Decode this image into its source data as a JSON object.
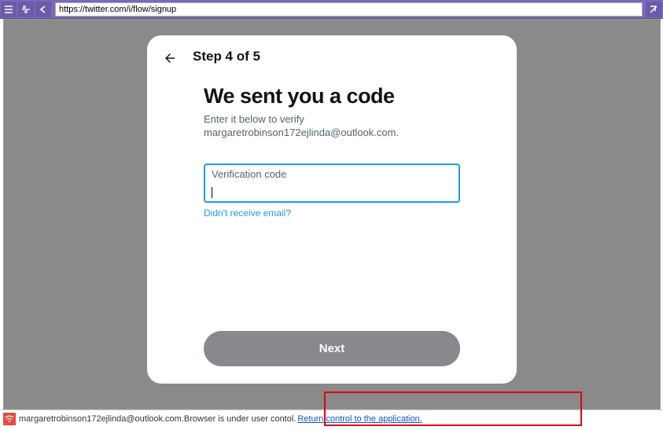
{
  "browser": {
    "url": "https://twitter.com/i/flow/signup"
  },
  "modal": {
    "step_label": "Step 4 of 5",
    "title": "We sent you a code",
    "subtitle_line1": "Enter it below to verify",
    "subtitle_line2": "margaretrobinson172ejlinda@outlook.com.",
    "input_label": "Verification code",
    "resend_link": "Didn't receive email?",
    "next_button": "Next"
  },
  "status": {
    "email": "margaretrobinson172ejlinda@outlook.com.",
    "text": " Browser is under user contol. ",
    "link": "Return control to the application."
  }
}
